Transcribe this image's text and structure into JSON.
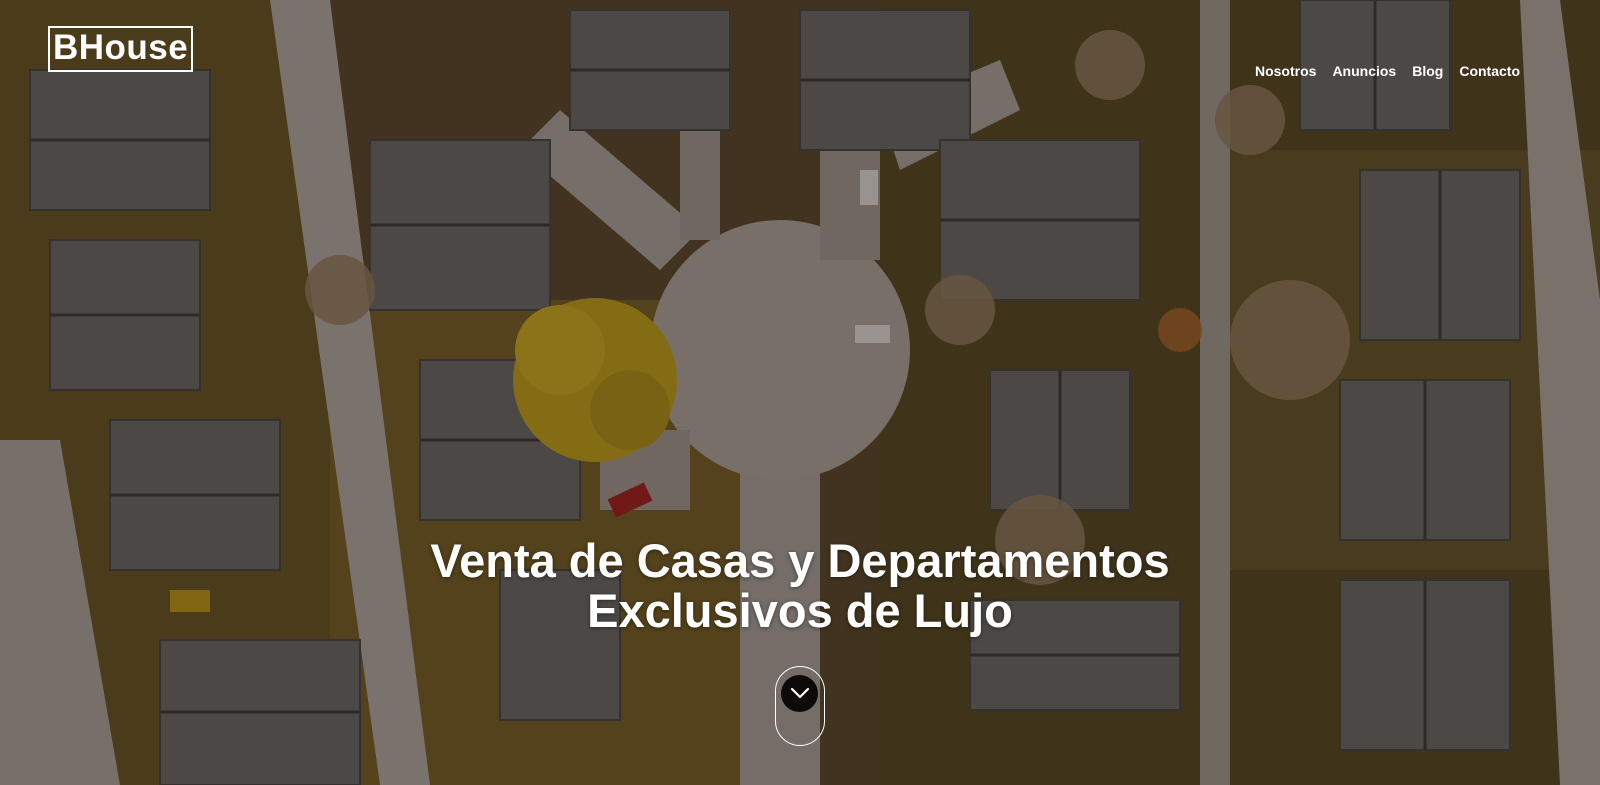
{
  "brand": {
    "logo_text": "BHouse"
  },
  "nav": {
    "items": [
      {
        "label": "Nosotros"
      },
      {
        "label": "Anuncios"
      },
      {
        "label": "Blog"
      },
      {
        "label": "Contacto"
      }
    ]
  },
  "hero": {
    "headline_line1": "Venta de Casas y Departamentos",
    "headline_line2": "Exclusivos de Lujo",
    "scroll_icon": "chevron-down-icon"
  },
  "colors": {
    "text": "#ffffff",
    "overlay": "#14100e",
    "foliage": "#c9a51a",
    "lawn": "#6e5a1e",
    "road": "#bcb2a8"
  }
}
